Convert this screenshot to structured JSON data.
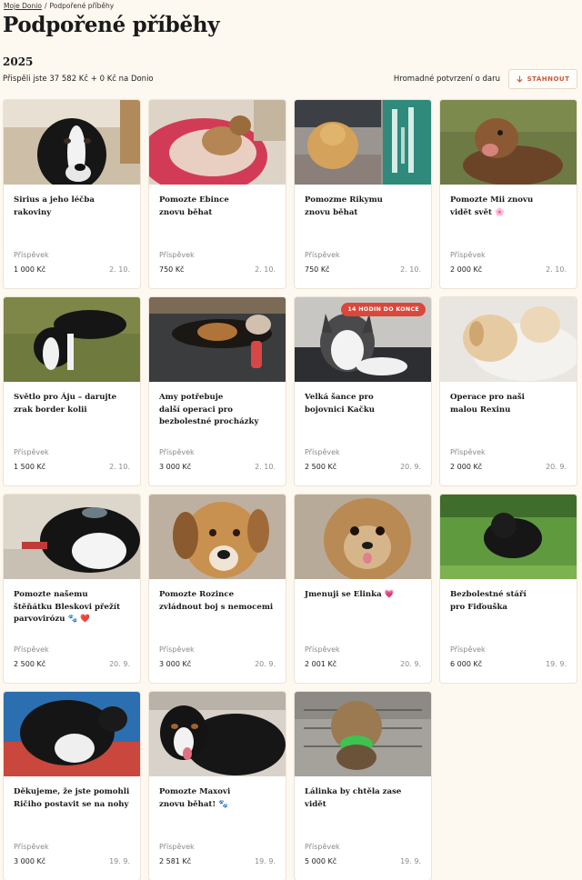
{
  "breadcrumb": {
    "home": "Moje Donio",
    "separator": "/",
    "current": "Podpořené příběhy"
  },
  "page_title": "Podpořené příběhy",
  "year": "2025",
  "summary": "Přispěli jste 37 582 Kč + 0 Kč na Donio",
  "bulk_confirmation_label": "Hromadné potvrzení o daru",
  "download_button": {
    "label": "STÁHNOUT",
    "icon": "download-arrow-icon"
  },
  "contribution_label": "Příspěvek",
  "colors": {
    "accent": "#c85a3a",
    "badge": "#d9483b",
    "background": "#fdf8f0"
  },
  "cards": [
    {
      "title": "Sirius a jeho léčba rakoviny",
      "amount": "1 000 Kč",
      "date": "2. 10.",
      "photo": "black-white-dog"
    },
    {
      "title": "Pomozte Ebince\nznovu běhat",
      "amount": "750 Kč",
      "date": "2. 10.",
      "photo": "small-dog-red-bed"
    },
    {
      "title": "Pomozme Rikymu\nznovu běhat",
      "amount": "750 Kč",
      "date": "2. 10.",
      "photo": "fluffy-dog-xray"
    },
    {
      "title": "Pomozte Mii znovu\nvidět svět 🌸",
      "amount": "2 000 Kč",
      "date": "2. 10.",
      "photo": "brown-dog-grass"
    },
    {
      "title": "Světlo pro Áju – darujte\nzrak border kolii",
      "amount": "1 500 Kč",
      "date": "2. 10.",
      "photo": "border-collie-grass"
    },
    {
      "title": "Amy potřebuje\ndalší operaci pro\nbezbolestné procházky",
      "amount": "3 000 Kč",
      "date": "2. 10.",
      "photo": "tricolor-dog-bandage"
    },
    {
      "title": "Velká šance pro\nbojovnici Kačku",
      "amount": "2 500 Kč",
      "date": "20. 9.",
      "photo": "husky-on-bed",
      "badge": "14 HODIN DO KONCE"
    },
    {
      "title": "Operace pro naši\nmalou Rexinu",
      "amount": "2 000 Kč",
      "date": "20. 9.",
      "photo": "light-puppy-blanket"
    },
    {
      "title": "Pomozte našemu\nštěňátku Bleskovi přežít\nparvovirózu 🐾 ❤️",
      "amount": "2 500 Kč",
      "date": "20. 9.",
      "photo": "black-white-puppy"
    },
    {
      "title": "Pomozte Rozince\nzvládnout boj s nemocemi",
      "amount": "3 000 Kč",
      "date": "20. 9.",
      "photo": "beagle-mix"
    },
    {
      "title": "Jmenuji se Elinka 💗",
      "amount": "2 001 Kč",
      "date": "20. 9.",
      "photo": "yorkshire-terrier"
    },
    {
      "title": "Bezbolestné stáří\npro Fiďouška",
      "amount": "6 000 Kč",
      "date": "19. 9.",
      "photo": "black-dog-lawn"
    },
    {
      "title": "Děkujeme, že jste pomohli\nRičiho postavit se na nohy",
      "amount": "3 000 Kč",
      "date": "19. 9.",
      "photo": "black-white-dog-lying"
    },
    {
      "title": "Pomozte Maxovi\nznovu běhat! 🐾",
      "amount": "2 581 Kč",
      "date": "19. 9.",
      "photo": "bernese-puppy"
    },
    {
      "title": "Lálinka by chtěla zase vidět",
      "amount": "5 000 Kč",
      "date": "19. 9.",
      "photo": "terrier-in-cart"
    }
  ]
}
